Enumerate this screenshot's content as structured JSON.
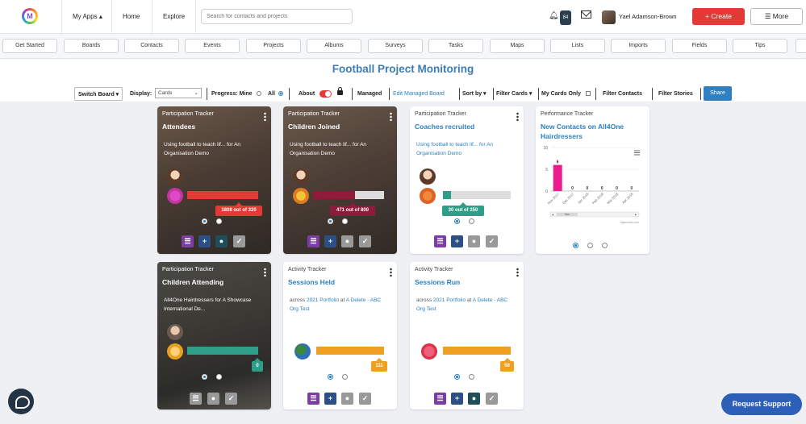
{
  "topnav": {
    "my_apps": "My Apps ▴",
    "home": "Home",
    "explore": "Explore",
    "search_placeholder": "Search for contacts and projects",
    "notif_count": "84",
    "user_name": "Yael Adamson-Brown",
    "create_label": "+ Create",
    "more_label": "☰ More"
  },
  "subnav": [
    "Get Started",
    "Boards",
    "Contacts",
    "Events",
    "Projects",
    "Albums",
    "Surveys",
    "Tasks",
    "Maps",
    "Lists",
    "Imports",
    "Fields",
    "Tips"
  ],
  "board": {
    "title": "Football Project Monitoring",
    "switch_board": "Switch Board ▾",
    "display_label": "Display:",
    "display_value": "Cards",
    "progress_label": "Progress: Mine",
    "all_label": "All",
    "about_label": "About",
    "managed": "Managed",
    "edit_managed": "Edit Managed Board",
    "sort_by": "Sort by ▾",
    "filter_cards": "Filter Cards ▾",
    "my_cards_only": "My Cards Only",
    "filter_contacts": "Filter Contacts",
    "filter_stories": "Filter Stories",
    "share": "Share"
  },
  "cards": [
    {
      "type": "Participation Tracker",
      "title": "Attendees",
      "desc_a": "Using football to teach lif... for An Organisation Demo",
      "progress_label": "1808 out of 320",
      "progress": 1.0
    },
    {
      "type": "Participation Tracker",
      "title": "Children Joined",
      "desc_a": "Using football to teach lif... for An Organisation Demo",
      "progress_label": "471 out of 800",
      "progress": 0.59
    },
    {
      "type": "Participation Tracker",
      "title": "Coaches recruited",
      "desc_a": "Using football to teach lif... for ",
      "desc_b": "An Organisation Demo",
      "progress_label": "30 out of 250",
      "progress": 0.12
    },
    {
      "type": "Performance Tracker",
      "title": "New Contacts on All4One Hairdressers"
    },
    {
      "type": "Participation Tracker",
      "title": "Children Attending",
      "desc_a": "All4One Hairdressers for A Showcase International De...",
      "progress_label": "0",
      "progress": 0.0
    },
    {
      "type": "Activity Tracker",
      "title": "Sessions Held",
      "desc_a": "across ",
      "desc_b": "2021 Portfolio",
      "desc_c": " at ",
      "desc_d": "A Delete - ABC Org Test",
      "progress_label": "111",
      "progress": 1.0
    },
    {
      "type": "Activity Tracker",
      "title": "Sessions Run",
      "desc_a": "across ",
      "desc_b": "2021 Portfolio",
      "desc_c": " at ",
      "desc_d": "A Delete - ABC Org Test",
      "progress_label": "58",
      "progress": 1.0
    }
  ],
  "chart_data": {
    "type": "bar",
    "title": "",
    "categories": [
      "Nov 2017",
      "Dec 2017",
      "Jan 2018",
      "Feb 2018",
      "Mar 2018",
      "Apr 2018"
    ],
    "values": [
      6,
      0,
      0,
      0,
      0,
      0
    ],
    "ylim": [
      0,
      10
    ],
    "yticks": [
      0,
      5,
      10
    ],
    "color": "#e91e8c",
    "credit": "Highcharts.com",
    "navigator_label": "Nov"
  },
  "support_label": "Request Support",
  "colors": {
    "accent": "#2a7fc1",
    "create": "#e53935",
    "red_bar": "#e53935",
    "maroon_bar": "#8e1b3a",
    "teal_bar": "#2f9e88",
    "orange_bar": "#f0a020"
  }
}
